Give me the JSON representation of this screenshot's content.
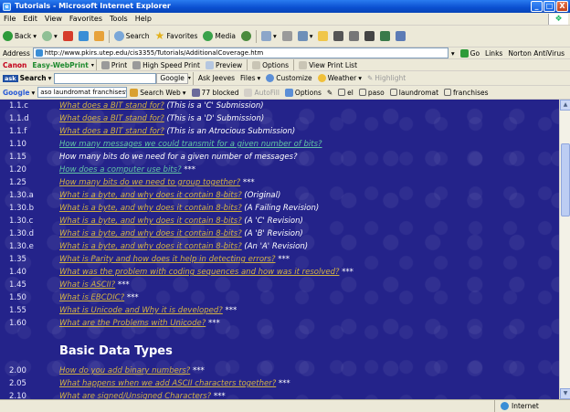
{
  "window": {
    "title": "Tutorials - Microsoft Internet Explorer",
    "buttons": [
      "_",
      "□",
      "X"
    ]
  },
  "menu": [
    "File",
    "Edit",
    "View",
    "Favorites",
    "Tools",
    "Help"
  ],
  "toolbar": {
    "back": "Back",
    "search": "Search",
    "favorites": "Favorites",
    "media": "Media"
  },
  "address": {
    "label": "Address",
    "url": "http://www.pkirs.utep.edu/cis3355/Tutorials/AdditionalCoverage.htm",
    "go": "Go",
    "links": "Links",
    "norton": "Norton AntiVirus"
  },
  "canon": {
    "brand": "Canon",
    "product": "Easy-WebPrint",
    "print": "Print",
    "hs_print": "High Speed Print",
    "preview": "Preview",
    "options": "Options",
    "view_list": "View Print List"
  },
  "ask": {
    "logo": "Search",
    "google": "Google",
    "ask_jeeves": "Ask Jeeves",
    "files": "Files",
    "customize": "Customize",
    "weather": "Weather",
    "highlight": "Highlight"
  },
  "googlebar": {
    "logo": "Google",
    "query": "aso laundromat franchises",
    "search_web": "Search Web",
    "blocked": "77 blocked",
    "autofill": "AutoFill",
    "options": "Options",
    "terms": [
      "el",
      "paso",
      "laundromat",
      "franchises"
    ]
  },
  "content": {
    "rows": [
      {
        "num": "1.1.c",
        "link": "What does a BIT stand for?",
        "visited": false,
        "suffix": " (This is a 'C' Submission)"
      },
      {
        "num": "1.1.d",
        "link": "What does a BIT stand for?",
        "visited": false,
        "suffix": " (This is a 'D' Submission)"
      },
      {
        "num": "1.1.f",
        "link": "What does a BIT stand for?",
        "visited": false,
        "suffix": " (This is an Atrocious Submission)"
      },
      {
        "num": "1.10",
        "link": "How many messages we could transmit for a given number of bits?",
        "visited": true,
        "suffix": ""
      },
      {
        "num": "1.15",
        "link": "",
        "visited": false,
        "suffix": "How many bits do we need for a given number of messages?"
      },
      {
        "num": "1.20",
        "link": "How does a computer use bits?",
        "visited": true,
        "suffix": " ***"
      },
      {
        "num": "1.25",
        "link": "How many bits do we need to group together?",
        "visited": false,
        "suffix": " ***"
      },
      {
        "num": "1.30.a",
        "link": "What is a byte, and why does it contain 8-bits?",
        "visited": false,
        "suffix": " (Original)"
      },
      {
        "num": "1.30.b",
        "link": "What is a byte, and why does it contain 8-bits?",
        "visited": false,
        "suffix": " (A Failing Revision)"
      },
      {
        "num": "1.30.c",
        "link": "What is a byte, and why does it contain 8-bits?",
        "visited": false,
        "suffix": " (A 'C' Revision)"
      },
      {
        "num": "1.30.d",
        "link": "What is a byte, and why does it contain 8-bits?",
        "visited": false,
        "suffix": " (A 'B' Revision)"
      },
      {
        "num": "1.30.e",
        "link": "What is a byte, and why does it contain 8-bits?",
        "visited": false,
        "suffix": " (An 'A' Revision)"
      },
      {
        "num": "1.35",
        "link": "What is Parity and how does it help in detecting errors?",
        "visited": false,
        "suffix": " ***"
      },
      {
        "num": "1.40",
        "link": "What was the problem with coding sequences and how was it resolved?",
        "visited": false,
        "suffix": " ***"
      },
      {
        "num": "1.45",
        "link": "What is ASCII?",
        "visited": false,
        "suffix": " ***"
      },
      {
        "num": "1.50",
        "link": "What is EBCDIC?",
        "visited": false,
        "suffix": " ***"
      },
      {
        "num": "1.55",
        "link": "What is Unicode and Why it is developed?",
        "visited": false,
        "suffix": " ***"
      },
      {
        "num": "1.60",
        "link": "What are the Problems with Unicode?",
        "visited": false,
        "suffix": " ***"
      }
    ],
    "heading": "Basic Data Types",
    "rows2": [
      {
        "num": "2.00",
        "link": "How do you add binary numbers?",
        "visited": false,
        "suffix": " ***"
      },
      {
        "num": "2.05",
        "link": "What happens when we add ASCII characters together?",
        "visited": false,
        "suffix": " ***"
      },
      {
        "num": "2.10",
        "link": "What are signed/Unsigned Characters?",
        "visited": false,
        "suffix": " ***"
      }
    ]
  },
  "status": {
    "zone": "Internet"
  }
}
